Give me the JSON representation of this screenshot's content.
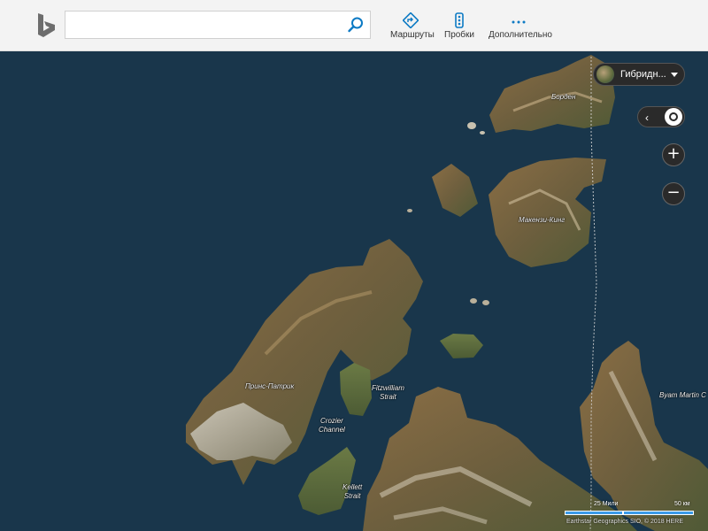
{
  "search": {
    "value": "",
    "placeholder": ""
  },
  "nav": [
    {
      "label": "Маршруты",
      "icon": "directions-icon"
    },
    {
      "label": "Пробки",
      "icon": "traffic-icon"
    },
    {
      "label": "Дополнительно",
      "icon": "more-icon"
    }
  ],
  "map_style": {
    "label": "Гибридн..."
  },
  "places": {
    "borden": "Борден",
    "mackenzie_king": "Макензи-Кинг",
    "prince_patrick": "Принс-Патрик",
    "fitzwilliam_line1": "Fitzwilliam",
    "fitzwilliam_line2": "Strait",
    "crozier_line1": "Crozier",
    "crozier_line2": "Channel",
    "kellett_line1": "Kellett",
    "kellett_line2": "Strait",
    "byam_martin": "Byam Martin C"
  },
  "zoom": {
    "in": "+",
    "out": "−"
  },
  "locate": {
    "chevron": "‹"
  },
  "scale": {
    "miles_label": "25 Мили",
    "km_label": "50 км"
  },
  "copyright": "Earthstar Geographics SIO, © 2018 HERE",
  "colors": {
    "ocean": "#1b3a4f",
    "accent": "#0c7ac4",
    "land": "#7d6a47"
  }
}
